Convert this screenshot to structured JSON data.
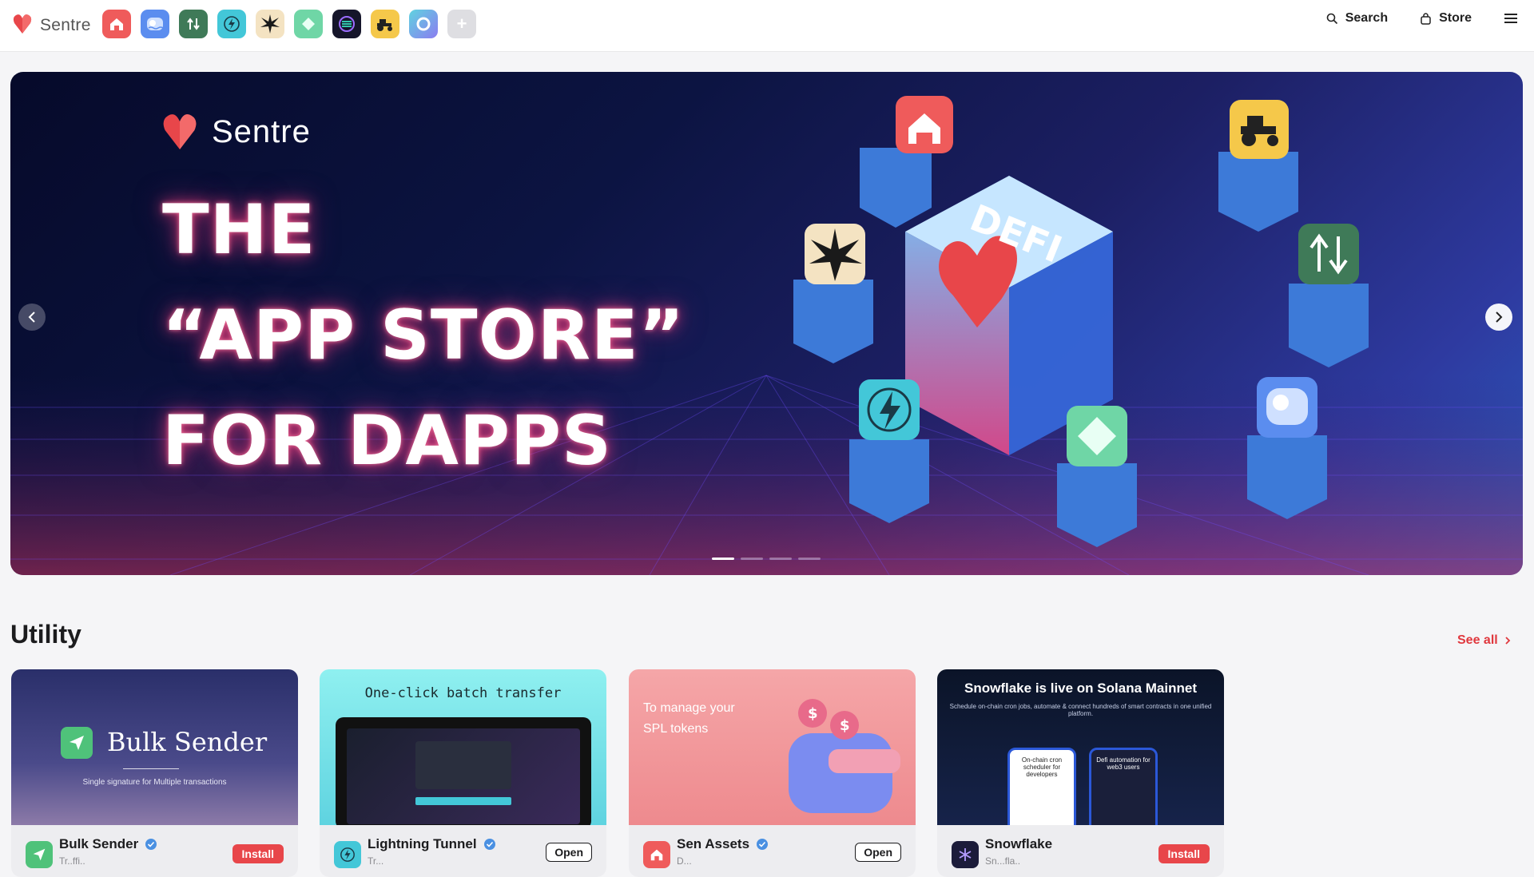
{
  "header": {
    "brand_name": "Sentre",
    "dock": [
      {
        "name": "sen-assets",
        "icon": "house-icon",
        "bg": "#ef5b5b"
      },
      {
        "name": "sen-lp",
        "icon": "pool-icon",
        "bg": "#5b8def"
      },
      {
        "name": "sen-swap",
        "icon": "swap-arrows-icon",
        "bg": "#3f7a58"
      },
      {
        "name": "lightning-tunnel",
        "icon": "bolt-icon",
        "bg": "#43c7d8"
      },
      {
        "name": "star-app",
        "icon": "star-burst-icon",
        "bg": "#f4e3c2"
      },
      {
        "name": "diamond-app",
        "icon": "diamond-icon",
        "bg": "#6fd6a6"
      },
      {
        "name": "solana-app",
        "icon": "solana-icon",
        "bg": "#15152a"
      },
      {
        "name": "farming-app",
        "icon": "tractor-icon",
        "bg": "#f5c84a"
      },
      {
        "name": "ring-app",
        "icon": "ring-icon",
        "bg": "#8b7cf0"
      },
      {
        "name": "add-app",
        "icon": "plus-icon",
        "bg": "#dedee2"
      }
    ],
    "search_label": "Search",
    "store_label": "Store"
  },
  "hero": {
    "logo_text": "Sentre",
    "line1": "THE",
    "line2": "“APP STORE”",
    "line3": "FOR DAPPS",
    "slide_count": 4,
    "active_slide": 1
  },
  "utility": {
    "title": "Utility",
    "see_all": "See all",
    "cards": [
      {
        "banner_title": "Bulk Sender",
        "banner_sub": "Single signature for Multiple transactions",
        "name": "Bulk Sender",
        "sub": "Tr..ffi..",
        "action": "Install",
        "icon": "paper-plane-icon",
        "icon_bg": "#4fc27a"
      },
      {
        "banner_title": "One-click batch transfer",
        "name": "Lightning Tunnel",
        "sub": "Tr...",
        "action": "Open",
        "icon": "bolt-icon",
        "icon_bg": "#43c7d8"
      },
      {
        "banner_title": "To manage your SPL tokens",
        "name": "Sen Assets",
        "sub": "D...",
        "action": "Open",
        "icon": "house-icon",
        "icon_bg": "#ef5b5b"
      },
      {
        "banner_title": "Snowflake is live on Solana Mainnet",
        "banner_sub": "Schedule on-chain cron jobs, automate & connect hundreds of smart contracts in one unified platform.",
        "phone_left": "On-chain cron scheduler for developers",
        "phone_right": "Defi automation for web3 users",
        "name": "Snowflake",
        "sub": "Sn...fla..",
        "action": "Install",
        "icon": "snowflake-icon",
        "icon_bg": "#1c1c3a"
      }
    ]
  },
  "colors": {
    "accent": "#e0383e",
    "install": "#e8464a",
    "hero_bg": "#0c1442"
  }
}
